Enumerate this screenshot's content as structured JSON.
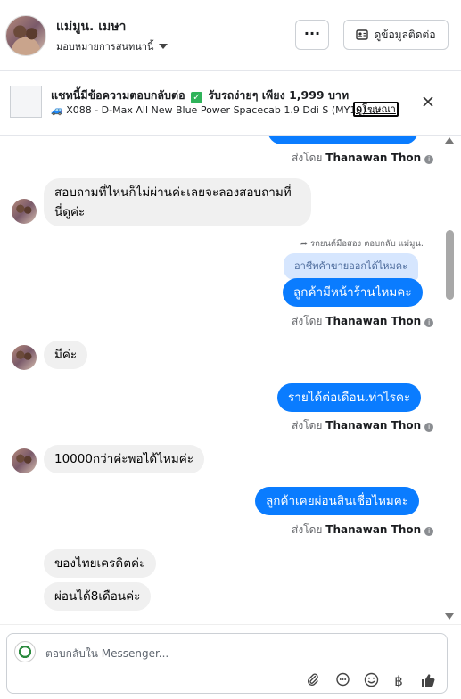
{
  "header": {
    "contact_name": "แม่มูน. เมษา",
    "assign_label": "มอบหมายการสนทนานี้",
    "more_label": "···",
    "contact_info_label": "ดูข้อมูลติดต่อ"
  },
  "ad": {
    "title_part1": "แชทนี้มีข้อความตอบกลับต่อ",
    "title_part2": "รับรถง่ายๆ เพียง 1,999 บาท",
    "subtitle": "🚙 X088 - D-Max All New Blue Power Spacecab 1.9 Ddi S (MY19) ...",
    "link_label": "ดูโฆษณา"
  },
  "agent_name": "Thanawan Thon",
  "sent_by_label": "ส่งโดย",
  "messages": [
    {
      "dir": "in",
      "line1": "สอบถามที่ไหนก็ไม่ผ่านค่ะเลยจะลองสอบถามที่",
      "line2": "นี่ดูค่ะ"
    },
    {
      "dir": "note",
      "text": "รถยนต์มือสอง ตอบกลับ แม่มูน."
    },
    {
      "dir": "quote",
      "text": "อาชีพค้าขายออกได้ไหมคะ"
    },
    {
      "dir": "out",
      "text": "ลูกค้ามีหน้าร้านไหมคะ"
    },
    {
      "dir": "in",
      "text": "มีค่ะ"
    },
    {
      "dir": "out",
      "text": "รายได้ต่อเดือนเท่าไรคะ"
    },
    {
      "dir": "in",
      "text": "10000กว่าค่ะพอได้ไหมค่ะ"
    },
    {
      "dir": "out",
      "text": "ลูกค้าเคยผ่อนสินเชื่อไหมคะ"
    },
    {
      "dir": "in",
      "text": "ของไทยเครดิตค่ะ"
    },
    {
      "dir": "in",
      "text": "ผ่อนได้8เดือนค่ะ"
    }
  ],
  "composer": {
    "placeholder": "ตอบกลับใน Messenger..."
  },
  "colors": {
    "outgoing_bubble": "#0a7cff",
    "incoming_bubble": "#f0f0f0",
    "quoted_bubble": "#d6e6fe"
  },
  "icons": [
    "more-icon",
    "contact-card-icon",
    "close-icon",
    "info-icon",
    "reply-arrow-icon",
    "attachment-icon",
    "chat-bubble-icon",
    "emoji-icon",
    "baht-icon",
    "thumbs-up-icon"
  ]
}
